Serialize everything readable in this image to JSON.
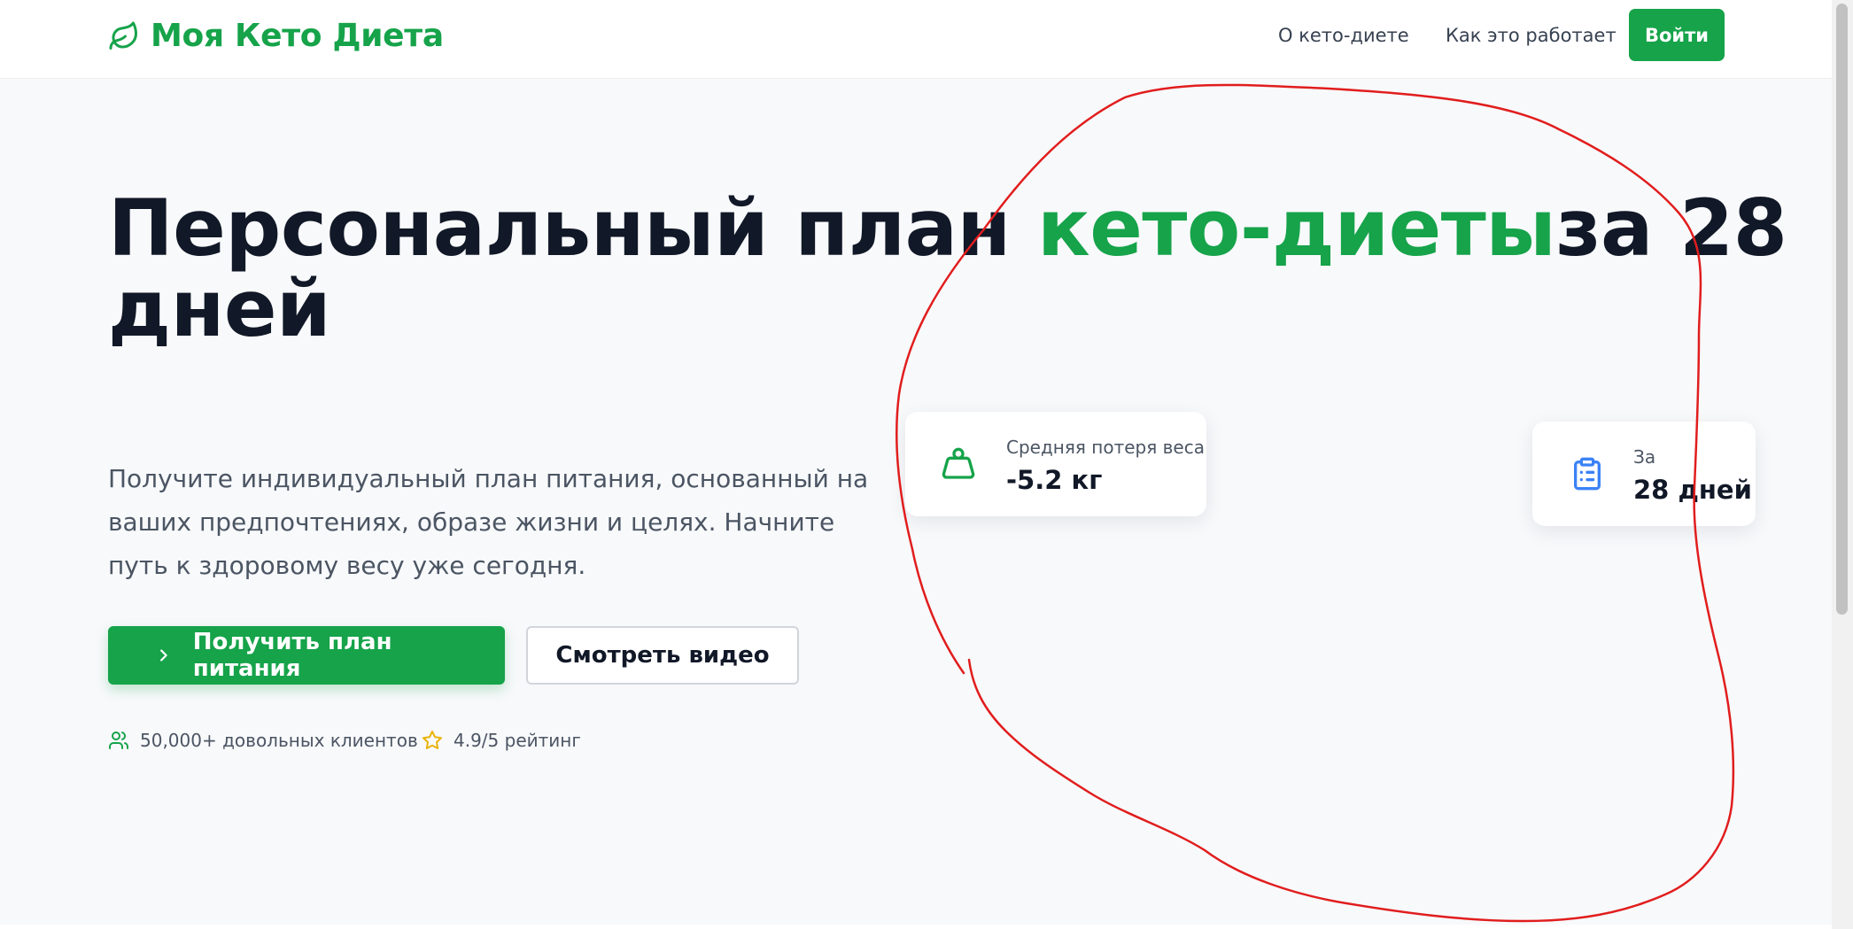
{
  "brand": {
    "name": "Моя Кето Диета",
    "icon": "leaf-icon",
    "color": "#16a34a"
  },
  "nav": {
    "links": [
      "О кето-диете",
      "Как это работает"
    ],
    "login_label": "Войти"
  },
  "hero": {
    "title_before": "Персональный план ",
    "title_accent": "кето-диеты",
    "title_after": "за 28 дней",
    "subtitle": "Получите индивидуальный план питания, основанный на ваших предпочтениях, образе жизни и целях. Начните путь к здоровому весу уже сегодня.",
    "primary_button": "Получить план питания",
    "secondary_button": "Смотреть видео",
    "stats": [
      {
        "icon": "users-icon",
        "text": "50,000+ довольных клиентов"
      },
      {
        "icon": "star-icon",
        "text": "4.9/5 рейтинг"
      }
    ]
  },
  "cards": [
    {
      "icon": "weight-icon",
      "label": "Средняя потеря веса",
      "value": "-5.2 кг"
    },
    {
      "icon": "clipboard-icon",
      "label": "За",
      "value": "28 дней"
    }
  ],
  "colors": {
    "accent": "#16a34a",
    "title": "#111827",
    "annotation": "#e11d1d",
    "clipboard_icon": "#3b82f6",
    "star_icon": "#eab308"
  }
}
